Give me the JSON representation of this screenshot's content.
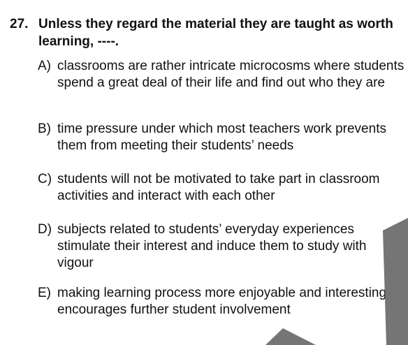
{
  "question": {
    "number": "27.",
    "stem": "Unless they regard the material they are taught as worth learning, ----.",
    "options": [
      {
        "letter": "A)",
        "text": "classrooms are rather intricate microcosms where students spend a great deal of their life and find out who they are"
      },
      {
        "letter": "B)",
        "text": "time pressure under which most teachers work prevents them from meeting their students’ needs"
      },
      {
        "letter": "C)",
        "text": "students will not be motivated to take part in classroom activities and interact with each other"
      },
      {
        "letter": "D)",
        "text": "subjects related to students’ everyday experiences stimulate their interest and induce them to study with vigour"
      },
      {
        "letter": "E)",
        "text": "making learning process more enjoyable and interesting encourages further student involvement"
      }
    ]
  },
  "colors": {
    "text": "#111111",
    "background": "#ffffff",
    "shadow": "#666666"
  }
}
